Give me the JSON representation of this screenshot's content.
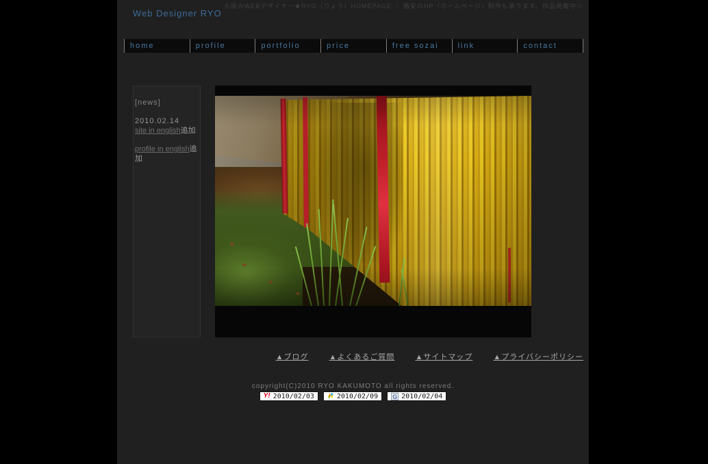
{
  "header": {
    "tagline": "大阪のWEBデザイナー★RYO（りょう）HOMEPAGE ｜ 格安のHP（ホームページ）制作も承ります。作品掲載中☆",
    "site_title": "Web Designer RYO"
  },
  "nav": {
    "items": [
      {
        "label": "home"
      },
      {
        "label": "profile"
      },
      {
        "label": "portfolio"
      },
      {
        "label": "price"
      },
      {
        "label": "free sozai"
      },
      {
        "label": "link"
      },
      {
        "label": "contact"
      }
    ]
  },
  "sidebar": {
    "heading": "[news]",
    "date": "2010.02.14",
    "items": [
      {
        "link_label": "site in english",
        "note": "追加"
      },
      {
        "link_label": "profile in english",
        "note": "追加"
      }
    ]
  },
  "photo": {
    "colors": {
      "fence_yellow": "#d6ab13",
      "post_red": "#c0202b",
      "grass_green": "#42581e"
    }
  },
  "footer": {
    "links": [
      {
        "label": "▲ブログ"
      },
      {
        "label": "▲よくあるご質問"
      },
      {
        "label": "▲サイトマップ"
      },
      {
        "label": "▲プライバシーポリシー"
      }
    ],
    "copyright": "copyright(C)2010 RYO KAKUMOTO all rights reserved.",
    "badges": [
      {
        "icon_text": "Y!",
        "date": "2010/02/03"
      },
      {
        "icon_text": "",
        "date": "2010/02/09"
      },
      {
        "icon_text": "G",
        "date": "2010/02/04"
      }
    ]
  },
  "colors": {
    "page_bg": "#000000",
    "column_bg": "#202020",
    "accent_blue": "#3d6b99",
    "nav_text": "#4a7aa3"
  }
}
